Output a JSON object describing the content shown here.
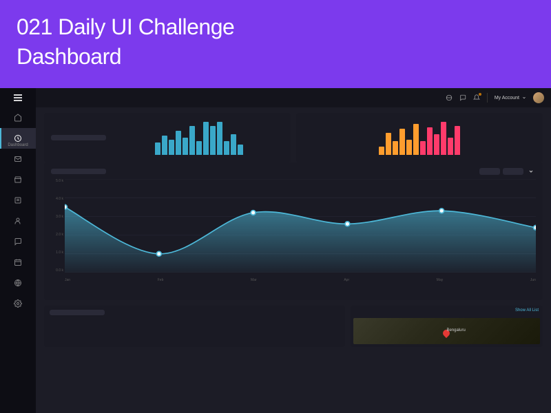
{
  "banner": {
    "line1": "021 Daily UI Challenge",
    "line2": "Dashboard"
  },
  "sidebar": {
    "items": [
      {
        "name": "home",
        "label": ""
      },
      {
        "name": "dashboard",
        "label": "Dashboard",
        "active": true
      },
      {
        "name": "inbox",
        "label": ""
      },
      {
        "name": "products",
        "label": ""
      },
      {
        "name": "orders",
        "label": ""
      },
      {
        "name": "users",
        "label": ""
      },
      {
        "name": "chat",
        "label": ""
      },
      {
        "name": "calendar",
        "label": ""
      },
      {
        "name": "globe",
        "label": ""
      },
      {
        "name": "settings",
        "label": ""
      }
    ]
  },
  "topbar": {
    "account_label": "My Account"
  },
  "map": {
    "city": "Bengaluru",
    "show_list": "Show All List"
  },
  "chart_data": [
    {
      "type": "bar",
      "series": [
        {
          "name": "teal",
          "values": [
            18,
            28,
            22,
            35,
            25,
            42,
            20,
            48,
            42,
            48,
            20,
            30,
            15
          ]
        }
      ],
      "colors": [
        "#3aa8c9"
      ]
    },
    {
      "type": "bar",
      "series": [
        {
          "name": "warm",
          "values": [
            12,
            32,
            20,
            38,
            22,
            45,
            20,
            40,
            30,
            48,
            25,
            42
          ]
        }
      ],
      "colors_gradient": {
        "from": "#ff9d2e",
        "to": "#ff3b6b"
      }
    },
    {
      "type": "area",
      "title": "",
      "x": [
        "Jan",
        "Feb",
        "Mar",
        "Apr",
        "May",
        "Jun"
      ],
      "y_ticks": [
        "5.0 k",
        "4.0 k",
        "3.0 k",
        "2.0 k",
        "1.0 k",
        "0.0 k"
      ],
      "ylim": [
        0,
        5
      ],
      "series": [
        {
          "name": "visitors",
          "values": [
            3.5,
            1.0,
            3.2,
            2.6,
            3.3,
            2.4
          ]
        }
      ],
      "accent": "#4db8d8"
    }
  ]
}
